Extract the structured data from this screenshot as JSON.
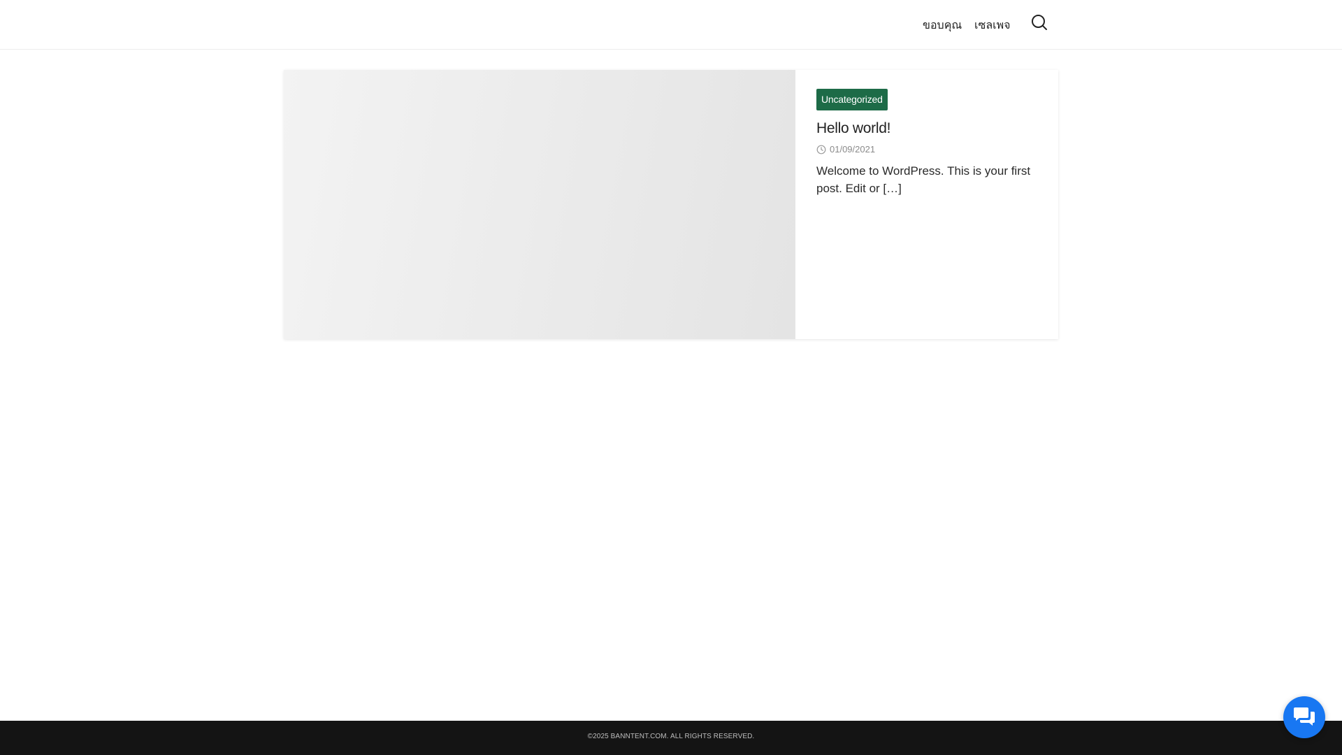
{
  "header": {
    "nav_items": [
      {
        "label": "ขอบคุณ"
      },
      {
        "label": "เซลเพจ"
      }
    ],
    "search_icon": "search-icon"
  },
  "post": {
    "category": "Uncategorized",
    "title": "Hello world!",
    "date": "01/09/2021",
    "excerpt": "Welcome to WordPress. This is your first post. Edit or […]",
    "date_icon": "clock-icon"
  },
  "footer": {
    "copyright": "©2025 BANNTENT.COM. ALL RIGHTS RESERVED."
  },
  "chat_button": {
    "icon": "chat-bubbles-icon"
  },
  "colors": {
    "category_badge": "#1d6b47",
    "footer_bg": "#141414",
    "chat_button": "#1877f2"
  }
}
